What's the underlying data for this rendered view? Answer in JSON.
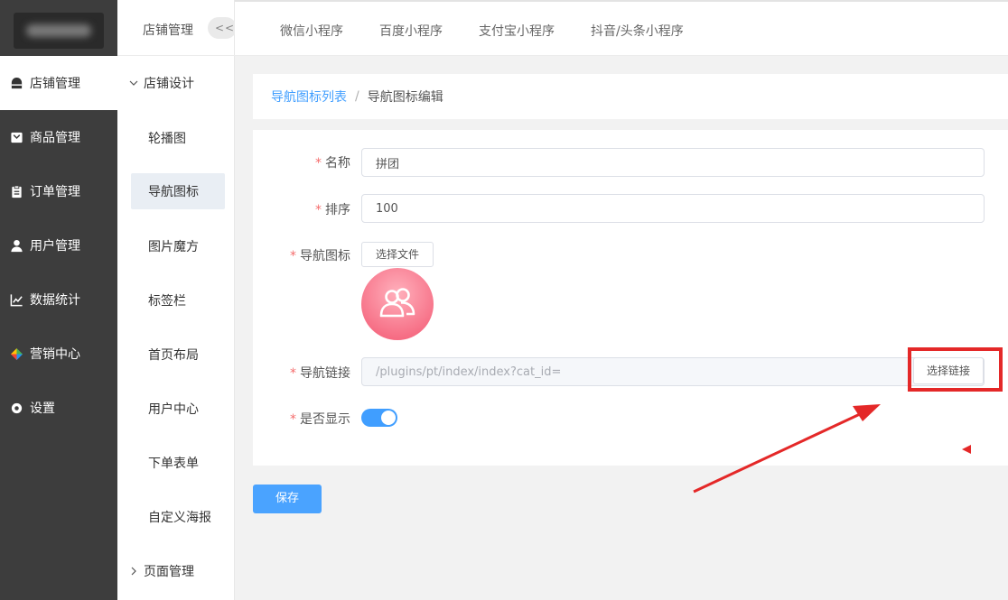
{
  "sidebar": {
    "items": [
      {
        "label": "店铺管理",
        "icon": "store-icon"
      },
      {
        "label": "商品管理",
        "icon": "goods-icon"
      },
      {
        "label": "订单管理",
        "icon": "order-icon"
      },
      {
        "label": "用户管理",
        "icon": "user-icon"
      },
      {
        "label": "数据统计",
        "icon": "chart-icon"
      },
      {
        "label": "营销中心",
        "icon": "marketing-icon"
      },
      {
        "label": "设置",
        "icon": "settings-icon"
      }
    ],
    "active": "店铺管理"
  },
  "subbar": {
    "title": "店铺管理",
    "collapse_label": "<<",
    "group_design": "店铺设计",
    "items": [
      "轮播图",
      "导航图标",
      "图片魔方",
      "标签栏",
      "首页布局",
      "用户中心",
      "下单表单",
      "自定义海报"
    ],
    "active": "导航图标",
    "group_page": "页面管理"
  },
  "tabs": [
    "微信小程序",
    "百度小程序",
    "支付宝小程序",
    "抖音/头条小程序"
  ],
  "breadcrumb": {
    "parent": "导航图标列表",
    "separator": "/",
    "current": "导航图标编辑"
  },
  "form": {
    "name_label": "名称",
    "name_value": "拼团",
    "sort_label": "排序",
    "sort_value": "100",
    "icon_label": "导航图标",
    "file_button": "选择文件",
    "link_label": "导航链接",
    "link_value": "/plugins/pt/index/index?cat_id=",
    "link_button": "选择链接",
    "display_label": "是否显示",
    "display_on": true,
    "required_mark": "*"
  },
  "save_button": "保存",
  "colors": {
    "primary": "#409eff",
    "sidebar_bg": "#3d3d3d",
    "annotation_red": "#e42828",
    "required": "#f56c6c"
  }
}
